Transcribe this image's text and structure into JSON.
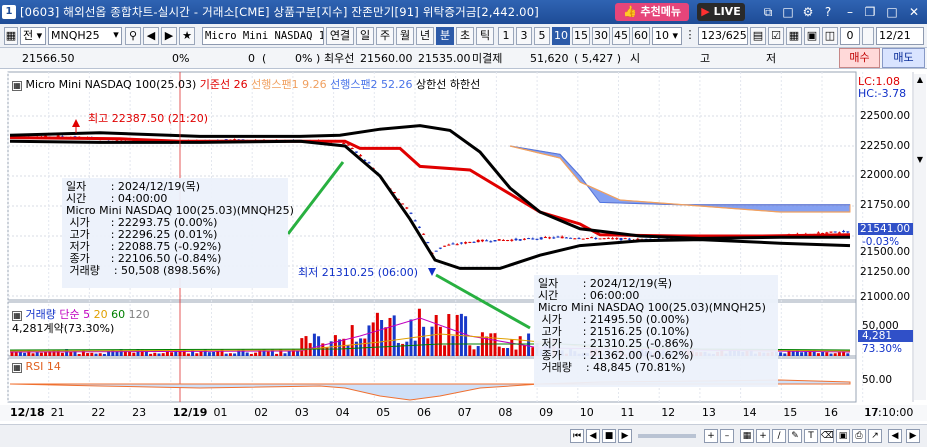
{
  "title_bar": {
    "window_number": "1",
    "title": "[0603] 해외선옵 종합차트-실시간 - 거래소[CME] 상품구분[지수] 잔존만기[91] 위탁증거금[2,442.00]",
    "menu_label": "추천메뉴",
    "live_label": "LIVE"
  },
  "toolbar": {
    "mode_label": "전",
    "symbol_code": "MNQH25",
    "product_name": "Micro Mini NASDAQ 100",
    "link_label": "연결",
    "periods": [
      "일",
      "주",
      "월",
      "년",
      "분",
      "초",
      "틱"
    ],
    "active_period": "분",
    "intervals": [
      "1",
      "3",
      "5",
      "10",
      "15",
      "30",
      "45",
      "60"
    ],
    "active_interval": "10",
    "interval_value": "10",
    "page_count": "123/625",
    "count_value": "0",
    "date_value": "12/21"
  },
  "quote_bar": {
    "current_price": "21566.50",
    "change_pct": "0%",
    "volume": "0",
    "volume_pct": "0%",
    "bid_label": "최우선",
    "bid_price": "21560.00",
    "ask_price": "21535.00",
    "unfilled_label": "미결제",
    "open_interest": "51,620",
    "oi_change": "( 5,427 )",
    "open_label": "시",
    "high_label": "고",
    "low_label": "저",
    "buy_label": "매수",
    "sell_label": "매도"
  },
  "price_legend": {
    "name": "Micro Mini NASDAQ 100(25.03)",
    "base_line": "기준선 26",
    "span1": "선행스팬1 9.26",
    "span2": "선행스팬2 52.26",
    "upper": "상한선",
    "lower": "하한선",
    "lc": "LC:1.08",
    "hc": "HC:-3.78",
    "colors": {
      "base": "#e00000",
      "span1": "#f0a060",
      "span2": "#4a74e8",
      "band": "#000000",
      "candle_up": "#e00000",
      "candle_down": "#1838c8"
    }
  },
  "price_axis": {
    "ticks": [
      "22500.00",
      "22250.00",
      "22000.00",
      "21750.00",
      "21500.00",
      "21250.00",
      "21000.00"
    ],
    "current_value": "21541.00",
    "current_pct": "-0.03%"
  },
  "annotations": {
    "high": "최고 22387.50 (21:20)",
    "low": "최저 21310.25 (06:00)"
  },
  "info_box_1": {
    "rows": [
      "일자       : 2024/12/19(목)",
      "시간       : 04:00:00",
      "Micro Mini NASDAQ 100(25.03)(MNQH25)",
      " 시가      : 22293.75 (0.00%)",
      " 고가      : 22296.25 (0.01%)",
      " 저가      : 22088.75 (-0.92%)",
      " 종가      : 22106.50 (-0.84%)",
      " 거래량    : 50,508 (898.56%)"
    ]
  },
  "info_box_2": {
    "rows": [
      "일자       : 2024/12/19(목)",
      "시간       : 06:00:00",
      "Micro Mini NASDAQ 100(25.03)(MNQH25)",
      " 시가      : 21495.50 (0.00%)",
      " 고가      : 21516.25 (0.10%)",
      " 저가      : 21310.25 (-0.86%)",
      " 종가      : 21362.00 (-0.62%)",
      " 거래량    : 48,845 (70.81%)"
    ]
  },
  "volume_legend": {
    "label": "거래량",
    "ma_label": "단순",
    "ma_values": [
      "5",
      "20",
      "60",
      "120"
    ],
    "ma_colors": [
      "#c000c0",
      "#e0a000",
      "#008000",
      "#808080"
    ],
    "contracts": "4,281계약(73.30%)",
    "axis_tick": "50,000",
    "current_value": "4,281",
    "current_pct": "73.30%"
  },
  "rsi_legend": {
    "label": "RSI 14",
    "axis_tick": "50.00"
  },
  "time_axis": {
    "labels": [
      "12/18",
      "21",
      "22",
      "23",
      "12/19",
      "01",
      "02",
      "03",
      "04",
      "05",
      "06",
      "07",
      "08",
      "09",
      "10",
      "11",
      "12",
      "13",
      "14",
      "15",
      "16",
      "17"
    ],
    "clock": "17:10:00"
  }
}
